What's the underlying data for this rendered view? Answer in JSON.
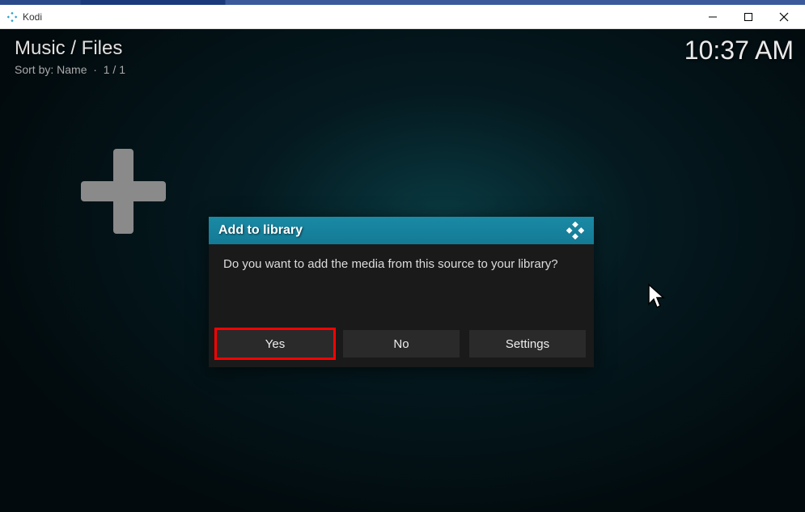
{
  "window": {
    "title": "Kodi"
  },
  "header": {
    "breadcrumb": "Music / Files",
    "sort_prefix": "Sort by:",
    "sort_value": "Name",
    "page_indicator": "1 / 1",
    "clock": "10:37 AM"
  },
  "dialog": {
    "title": "Add to library",
    "message": "Do you want to add the media from this source to your library?",
    "buttons": {
      "yes": "Yes",
      "no": "No",
      "settings": "Settings"
    }
  }
}
